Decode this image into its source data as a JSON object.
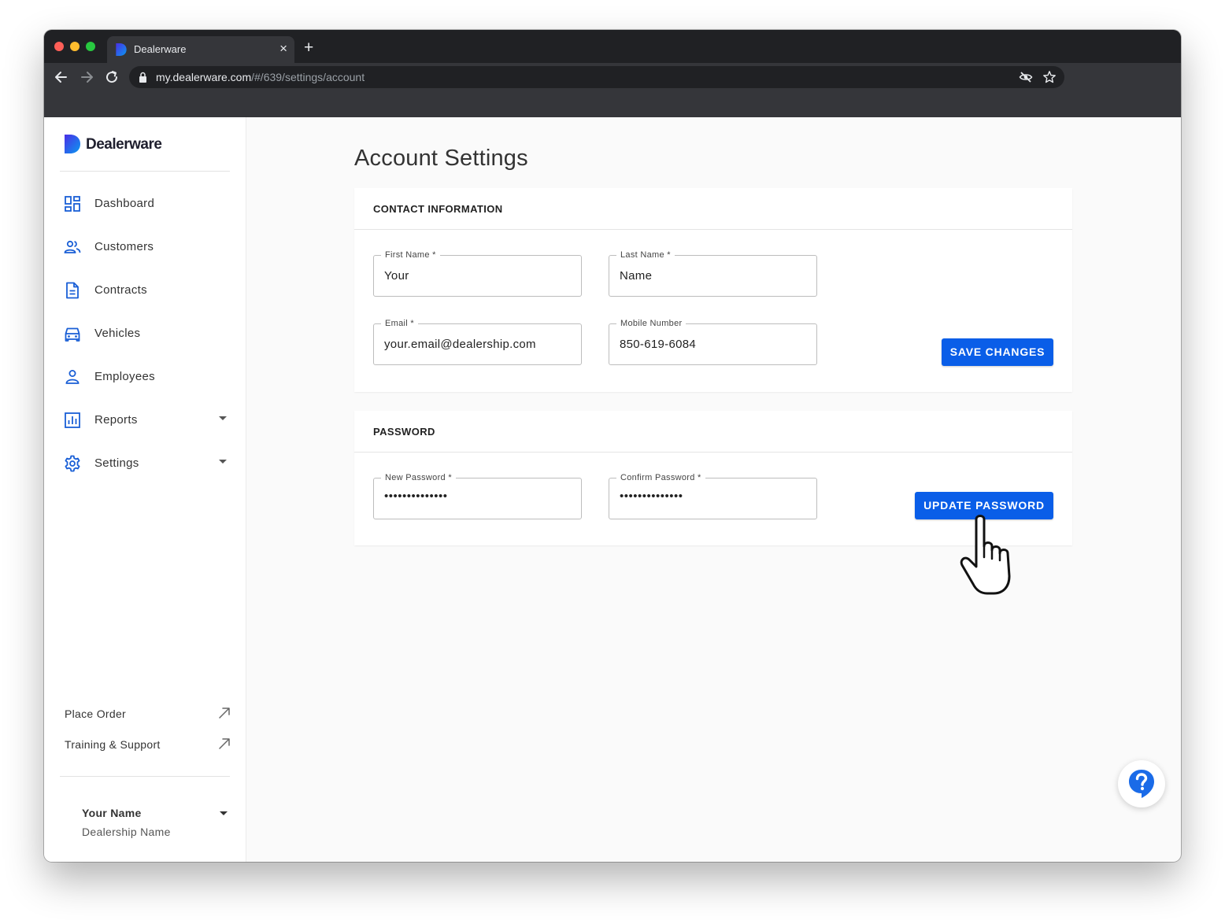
{
  "browser": {
    "tab_title": "Dealerware",
    "url_host": "my.dealerware.com",
    "url_path": "/#/639/settings/account"
  },
  "sidebar": {
    "logo_text": "Dealerware",
    "nav": [
      {
        "label": "Dashboard",
        "icon": "dashboard-icon"
      },
      {
        "label": "Customers",
        "icon": "people-icon"
      },
      {
        "label": "Contracts",
        "icon": "document-icon"
      },
      {
        "label": "Vehicles",
        "icon": "car-icon"
      },
      {
        "label": "Employees",
        "icon": "person-icon"
      },
      {
        "label": "Reports",
        "icon": "bar-chart-icon",
        "has_dropdown": true
      },
      {
        "label": "Settings",
        "icon": "gear-icon",
        "has_dropdown": true
      }
    ],
    "external_links": [
      {
        "label": "Place Order",
        "icon": "arrow-up-right-icon"
      },
      {
        "label": "Training & Support",
        "icon": "arrow-up-right-icon"
      }
    ],
    "user": {
      "name": "Your Name",
      "dealership": "Dealership Name"
    }
  },
  "main": {
    "page_title": "Account Settings",
    "contact": {
      "title": "CONTACT INFORMATION",
      "first_name": {
        "label": "First Name *",
        "value": "Your"
      },
      "last_name": {
        "label": "Last Name *",
        "value": "Name"
      },
      "email": {
        "label": "Email *",
        "value": "your.email@dealership.com"
      },
      "mobile": {
        "label": "Mobile Number",
        "value": "850-619-6084"
      },
      "save_label": "SAVE CHANGES"
    },
    "password": {
      "title": "PASSWORD",
      "new_password": {
        "label": "New Password *",
        "value": "••••••••••••••"
      },
      "confirm_password": {
        "label": "Confirm Password *",
        "value": "••••••••••••••"
      },
      "update_label": "UPDATE PASSWORD"
    }
  },
  "colors": {
    "accent": "#0a5ee8",
    "logo_gradient_start": "#3b3fe8",
    "logo_gradient_end": "#0a8cf0"
  }
}
